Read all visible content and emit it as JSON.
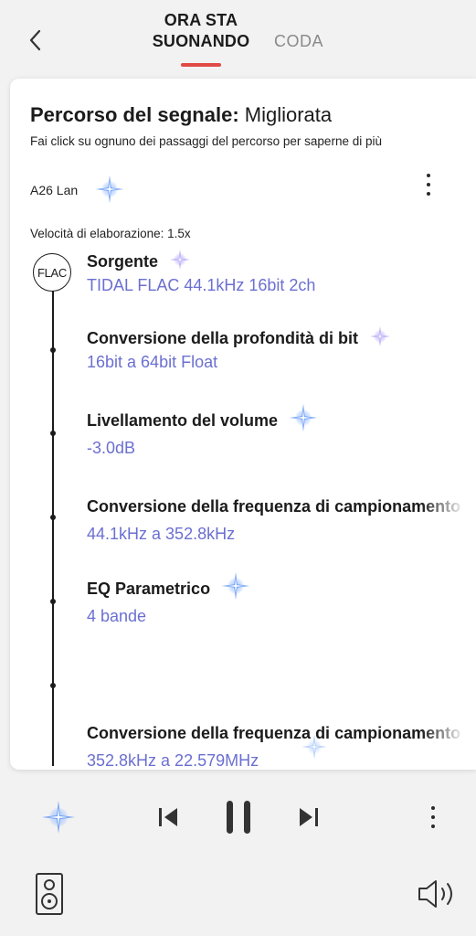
{
  "header": {
    "tab_now_playing_line1": "ORA STA",
    "tab_now_playing_line2": "SUONANDO",
    "tab_queue": "CODA"
  },
  "card": {
    "title_bold": "Percorso del segnale:",
    "title_rest": " Migliorata",
    "subtitle": "Fai click su ognuno dei passaggi del percorso per saperne di più",
    "device_name": "A26 Lan",
    "speed_label": "Velocità di elaborazione: 1.5x",
    "source_badge": "FLAC",
    "steps": [
      {
        "title": "Sorgente",
        "value": "TIDAL FLAC 44.1kHz 16bit 2ch"
      },
      {
        "title": "Conversione della profondità di bit",
        "value": "16bit a 64bit Float"
      },
      {
        "title": "Livellamento del volume",
        "value": "-3.0dB"
      },
      {
        "title": "Conversione della frequenza di campionamento",
        "value": "44.1kHz a 352.8kHz"
      },
      {
        "title": "EQ Parametrico",
        "value": "4 bande"
      },
      {
        "title": "Conversione della frequenza di campionamento",
        "value": "352.8kHz a 22.579MHz"
      }
    ]
  },
  "colors": {
    "accent_red": "#e14b45",
    "value_purple": "#6b6fd1",
    "sparkle_blue": "#4f8ff0"
  },
  "icons": {
    "back": "chevron-left-icon",
    "sparkle": "sparkle-icon",
    "more": "more-vertical-icon",
    "prev": "skip-previous-icon",
    "pause": "pause-icon",
    "next": "skip-next-icon",
    "speaker": "speaker-icon",
    "volume": "volume-icon"
  }
}
